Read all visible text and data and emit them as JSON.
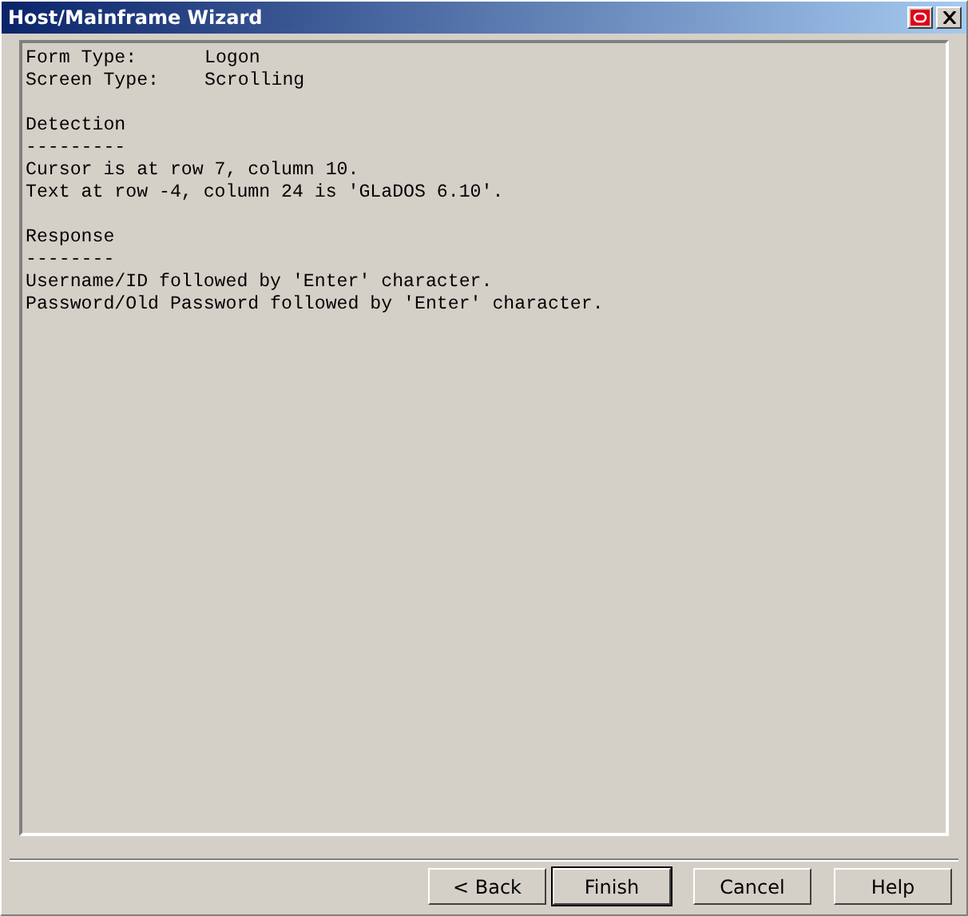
{
  "window": {
    "title": "Host/Mainframe Wizard"
  },
  "report": {
    "fields": [
      {
        "label": "Form Type:",
        "value": "Logon"
      },
      {
        "label": "Screen Type:",
        "value": "Scrolling"
      }
    ],
    "sections": [
      {
        "title": "Detection",
        "underline": "---------",
        "lines": [
          "Cursor is at row 7, column 10.",
          "Text at row -4, column 24 is 'GLaDOS 6.10'."
        ]
      },
      {
        "title": "Response",
        "underline": "--------",
        "lines": [
          "Username/ID followed by 'Enter' character.",
          "Password/Old Password followed by 'Enter' character."
        ]
      }
    ]
  },
  "buttons": [
    {
      "label": "< Back",
      "default": false
    },
    {
      "label": "Finish",
      "default": true
    },
    {
      "label": "Cancel",
      "default": false
    },
    {
      "label": "Help",
      "default": false
    }
  ]
}
